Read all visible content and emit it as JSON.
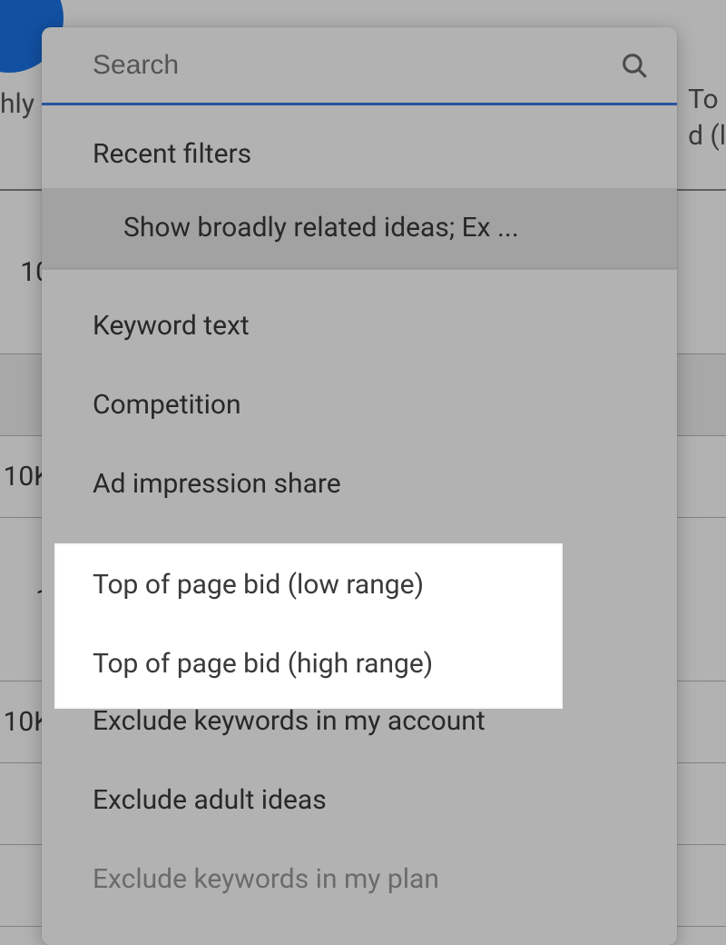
{
  "background": {
    "header_left_fragment": "hly",
    "header_right_line1": "To",
    "header_right_line2": "d (l",
    "rows": [
      "10",
      "10K",
      "1",
      "10K"
    ]
  },
  "dropdown": {
    "search_placeholder": "Search",
    "recent_label": "Recent filters",
    "recent_item": "Show broadly related ideas; Ex ...",
    "filters": [
      "Keyword text",
      "Competition",
      "Ad impression share",
      "Top of page bid (low range)",
      "Top of page bid (high range)",
      "Exclude keywords in my account",
      "Exclude adult ideas",
      "Exclude keywords in my plan"
    ]
  },
  "highlighted_filters": [
    "Top of page bid (low range)",
    "Top of page bid (high range)"
  ]
}
